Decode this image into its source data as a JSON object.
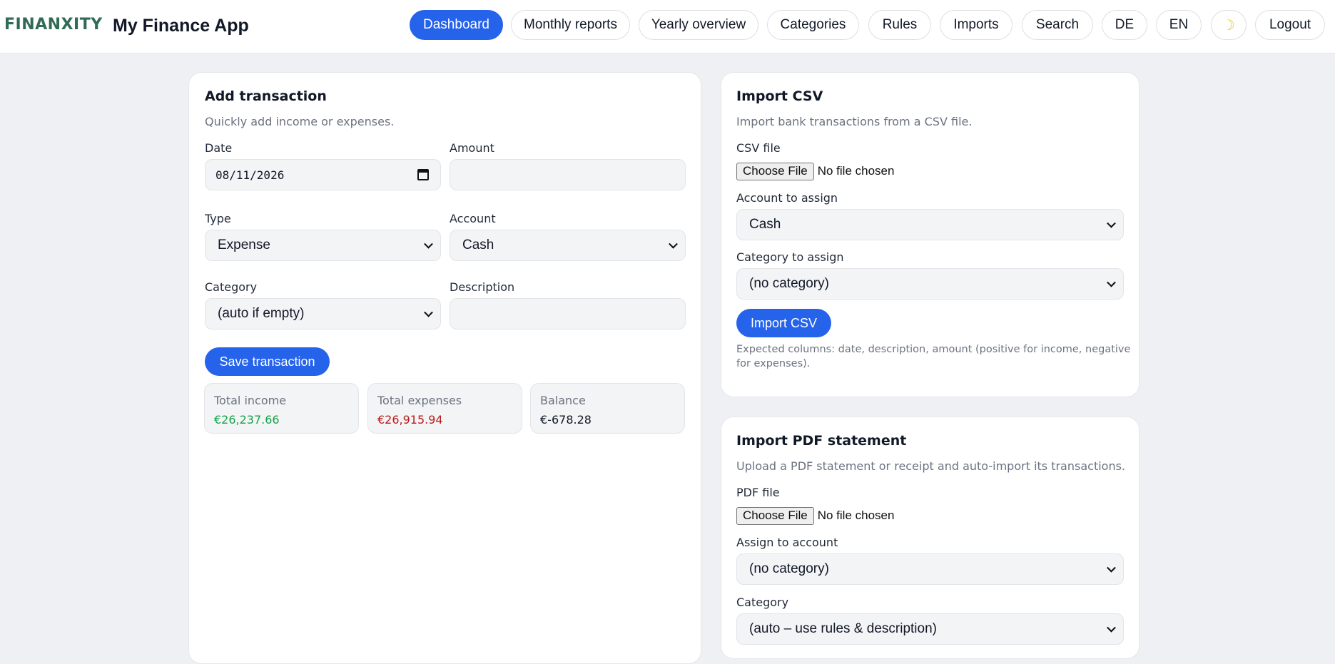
{
  "header": {
    "logo": "FINANXITY",
    "app_title": "My Finance App",
    "nav": [
      {
        "label": "Dashboard",
        "active": true
      },
      {
        "label": "Monthly reports"
      },
      {
        "label": "Yearly overview"
      },
      {
        "label": "Categories"
      },
      {
        "label": "Rules"
      },
      {
        "label": "Imports"
      },
      {
        "label": "Search"
      },
      {
        "label": "DE"
      },
      {
        "label": "EN"
      },
      {
        "label": "",
        "icon": "moon-icon"
      },
      {
        "label": "Logout"
      }
    ]
  },
  "add_transaction": {
    "title": "Add transaction",
    "subtitle": "Quickly add income or expenses.",
    "date_label": "Date",
    "date_value": "08/11/2026",
    "amount_label": "Amount",
    "amount_value": "",
    "type_label": "Type",
    "type_value": "Expense",
    "account_label": "Account",
    "account_value": "Cash",
    "category_label": "Category",
    "category_value": "(auto if empty)",
    "description_label": "Description",
    "description_value": "",
    "save_label": "Save transaction",
    "stats": {
      "income_label": "Total income",
      "income_value": "€26,237.66",
      "expenses_label": "Total expenses",
      "expenses_value": "€26,915.94",
      "balance_label": "Balance",
      "balance_value": "€-678.28"
    },
    "colors": {
      "income": "#16a34a",
      "expenses": "#b91c1c",
      "balance": "#111827"
    }
  },
  "import_csv": {
    "title": "Import CSV",
    "subtitle": "Import bank transactions from a CSV file.",
    "file_label": "CSV file",
    "file_button": "Choose File",
    "file_status": "No file chosen",
    "account_label": "Account to assign",
    "account_value": "Cash",
    "category_label": "Category to assign",
    "category_value": "(no category)",
    "import_label": "Import CSV",
    "hint_line1": "Expected columns: date, description, amount (positive for income, negative",
    "hint_line2": "for expenses)."
  },
  "import_pdf": {
    "title": "Import PDF statement",
    "subtitle": "Upload a PDF statement or receipt and auto-import its transactions.",
    "file_label": "PDF file",
    "file_button": "Choose File",
    "file_status": "No file chosen",
    "account_label": "Assign to account",
    "account_value": "(no category)",
    "category_label": "Category",
    "category_value": "(auto – use rules & description)"
  },
  "theme": {
    "accent": "#2563eb",
    "logo_color": "#2f6b55",
    "background": "#eef0f3"
  }
}
